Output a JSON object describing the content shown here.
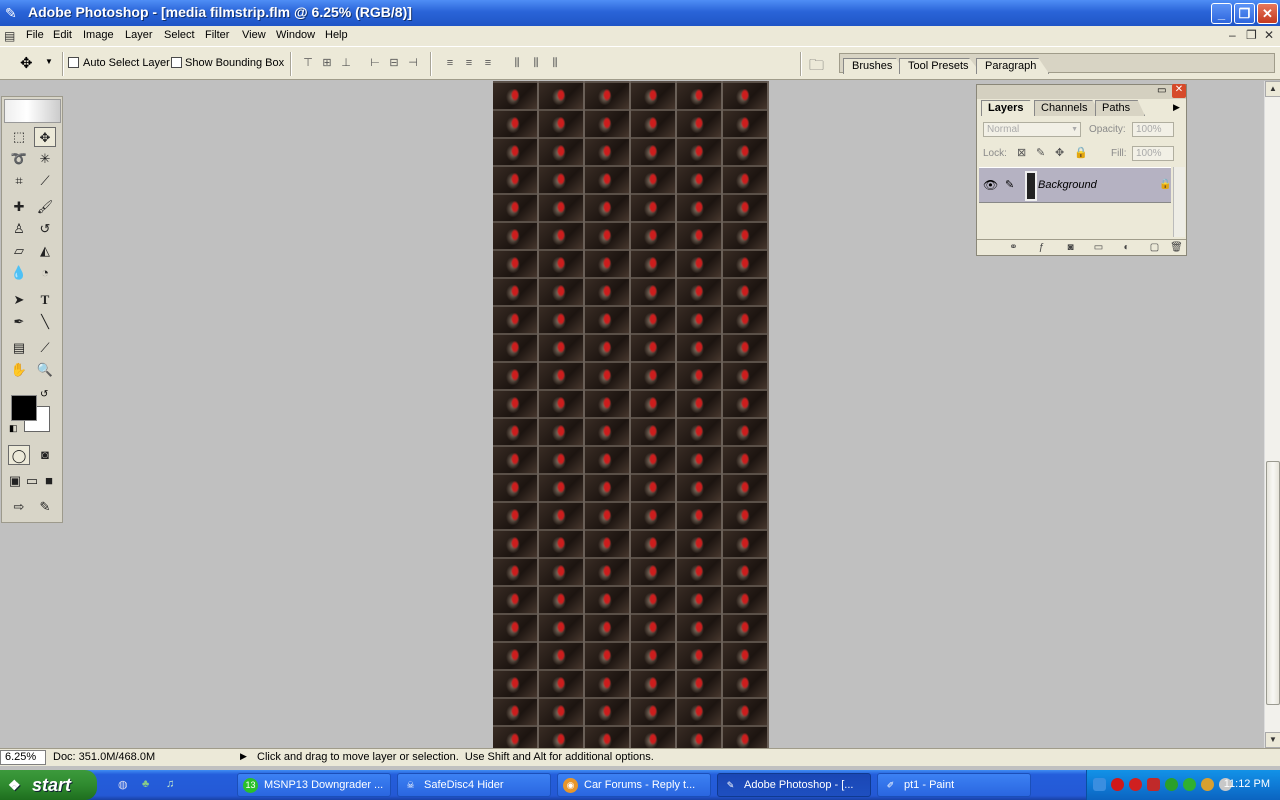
{
  "window": {
    "title": "Adobe Photoshop - [media filmstrip.flm @ 6.25% (RGB/8)]"
  },
  "menu": [
    "File",
    "Edit",
    "Image",
    "Layer",
    "Select",
    "Filter",
    "View",
    "Window",
    "Help"
  ],
  "options": {
    "auto_select": "Auto Select Layer",
    "bounding_box": "Show Bounding Box"
  },
  "palette_well": [
    "Brushes",
    "Tool Presets",
    "Paragraph"
  ],
  "layers_panel": {
    "tabs": [
      "Layers",
      "Channels",
      "Paths"
    ],
    "blend_mode": "Normal",
    "opacity_label": "Opacity:",
    "opacity_value": "100%",
    "lock_label": "Lock:",
    "fill_label": "Fill:",
    "fill_value": "100%",
    "layer_name": "Background"
  },
  "status": {
    "zoom": "6.25%",
    "doc": "Doc: 351.0M/468.0M",
    "hint": "Click and drag to move layer or selection.  Use Shift and Alt for additional options."
  },
  "taskbar": {
    "start": "start",
    "tasks": [
      "MSNP13 Downgrader ...",
      "SafeDisc4 Hider",
      "Car Forums - Reply t...",
      "Adobe Photoshop - [...",
      "pt1 - Paint"
    ],
    "clock": "11:12 PM",
    "badge": "13"
  }
}
